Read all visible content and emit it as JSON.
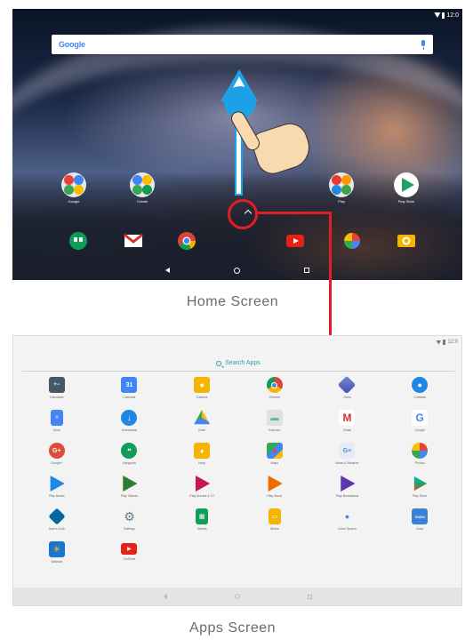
{
  "home_screen": {
    "status_time": "12:0",
    "search_logo": "Google",
    "caption": "Home Screen",
    "icons": [
      {
        "label": "Google"
      },
      {
        "label": "Create"
      },
      {
        "label": "Play"
      },
      {
        "label": "Play Store"
      }
    ]
  },
  "apps_screen": {
    "status_time": "12:0",
    "search_label": "Search Apps",
    "caption": "Apps Screen",
    "apps": [
      {
        "label": "Calculator"
      },
      {
        "label": "Calendar"
      },
      {
        "label": "Camera"
      },
      {
        "label": "Chrome"
      },
      {
        "label": "Clock"
      },
      {
        "label": "Contacts"
      },
      {
        "label": "Docs"
      },
      {
        "label": "Downloads"
      },
      {
        "label": "Drive"
      },
      {
        "label": "Explorer"
      },
      {
        "label": "Gmail"
      },
      {
        "label": "Google"
      },
      {
        "label": "Google+"
      },
      {
        "label": "Hangouts"
      },
      {
        "label": "Keep"
      },
      {
        "label": "Maps"
      },
      {
        "label": "News & Weather"
      },
      {
        "label": "Photos"
      },
      {
        "label": "Play Books"
      },
      {
        "label": "Play Games"
      },
      {
        "label": "Play Movies & TV"
      },
      {
        "label": "Play Music"
      },
      {
        "label": "Play Newsstand"
      },
      {
        "label": "Play Store"
      },
      {
        "label": "Sam's Club"
      },
      {
        "label": "Settings"
      },
      {
        "label": "Sheets"
      },
      {
        "label": "Slides"
      },
      {
        "label": "Voice Search"
      },
      {
        "label": "Vudu"
      },
      {
        "label": "Walmart"
      },
      {
        "label": "YouTube"
      }
    ]
  },
  "colors": {
    "swipe_arrow": "#1fa3e8",
    "highlight": "#e01e27",
    "search_accent": "#2aa39a"
  }
}
